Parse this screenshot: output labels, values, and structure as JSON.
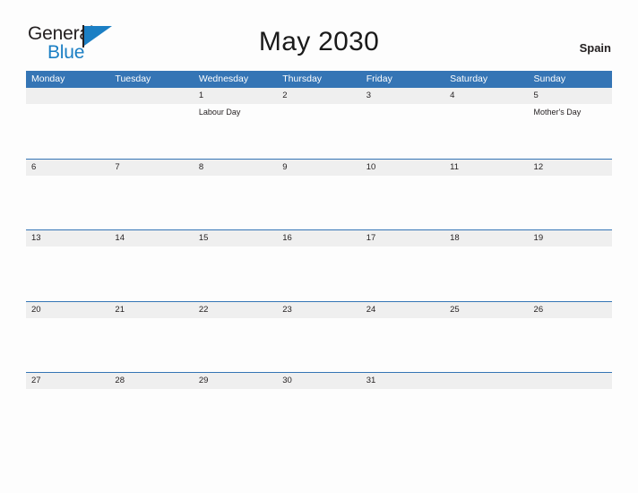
{
  "logo": {
    "word_one": "General",
    "word_two": "Blue",
    "flag_icon": "triangle-flag-icon",
    "blue": "#1b7fc4"
  },
  "header": {
    "title": "May 2030",
    "country": "Spain"
  },
  "colors": {
    "header_blue": "#3575b5",
    "band_gray": "#efefef",
    "page_background": "#fdfdfd",
    "text": "#231f20"
  },
  "calendar": {
    "weekdays": [
      "Monday",
      "Tuesday",
      "Wednesday",
      "Thursday",
      "Friday",
      "Saturday",
      "Sunday"
    ],
    "weeks": [
      {
        "days": [
          {
            "date": "",
            "event": ""
          },
          {
            "date": "",
            "event": ""
          },
          {
            "date": "1",
            "event": "Labour Day"
          },
          {
            "date": "2",
            "event": ""
          },
          {
            "date": "3",
            "event": ""
          },
          {
            "date": "4",
            "event": ""
          },
          {
            "date": "5",
            "event": "Mother's Day"
          }
        ]
      },
      {
        "days": [
          {
            "date": "6",
            "event": ""
          },
          {
            "date": "7",
            "event": ""
          },
          {
            "date": "8",
            "event": ""
          },
          {
            "date": "9",
            "event": ""
          },
          {
            "date": "10",
            "event": ""
          },
          {
            "date": "11",
            "event": ""
          },
          {
            "date": "12",
            "event": ""
          }
        ]
      },
      {
        "days": [
          {
            "date": "13",
            "event": ""
          },
          {
            "date": "14",
            "event": ""
          },
          {
            "date": "15",
            "event": ""
          },
          {
            "date": "16",
            "event": ""
          },
          {
            "date": "17",
            "event": ""
          },
          {
            "date": "18",
            "event": ""
          },
          {
            "date": "19",
            "event": ""
          }
        ]
      },
      {
        "days": [
          {
            "date": "20",
            "event": ""
          },
          {
            "date": "21",
            "event": ""
          },
          {
            "date": "22",
            "event": ""
          },
          {
            "date": "23",
            "event": ""
          },
          {
            "date": "24",
            "event": ""
          },
          {
            "date": "25",
            "event": ""
          },
          {
            "date": "26",
            "event": ""
          }
        ]
      },
      {
        "days": [
          {
            "date": "27",
            "event": ""
          },
          {
            "date": "28",
            "event": ""
          },
          {
            "date": "29",
            "event": ""
          },
          {
            "date": "30",
            "event": ""
          },
          {
            "date": "31",
            "event": ""
          },
          {
            "date": "",
            "event": ""
          },
          {
            "date": "",
            "event": ""
          }
        ]
      }
    ]
  }
}
